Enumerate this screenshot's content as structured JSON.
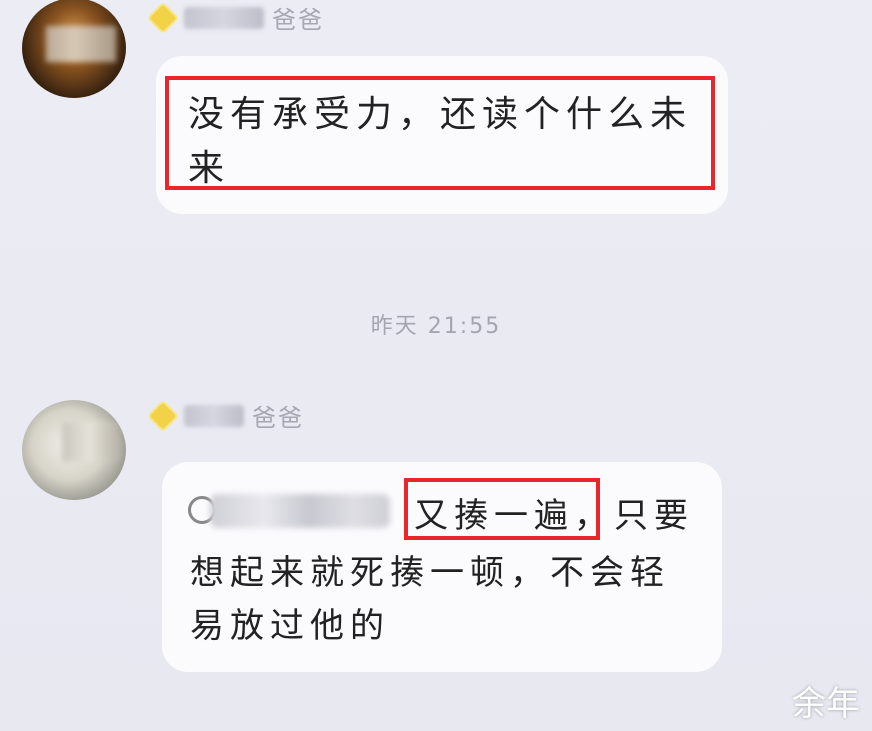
{
  "messages": [
    {
      "sender": {
        "name_suffix": "爸爸",
        "avatar": "blurred-avatar-dark"
      },
      "text": "没有承受力，还读个什么未来"
    },
    {
      "sender": {
        "name_suffix": "爸爸",
        "avatar": "blurred-avatar-light"
      },
      "mention": "@",
      "highlighted_text": "又揍一遍，",
      "text_line1_rest": "只要",
      "text_line2": "想起来就死揍一顿，不会轻",
      "text_line3": "易放过他的"
    }
  ],
  "timestamp": "昨天 21:55",
  "watermark": "余年",
  "colors": {
    "highlight": "#e8262b",
    "background": "#e9e9f2",
    "bubble": "#fbfbfd",
    "badge": "#f2d348"
  },
  "icons": {
    "badge": "diamond-icon"
  }
}
